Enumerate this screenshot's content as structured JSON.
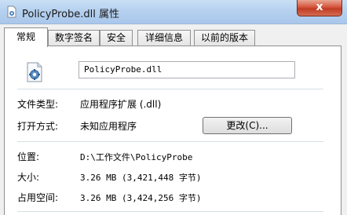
{
  "window": {
    "title": "PolicyProbe.dll 属性",
    "close_label": "x"
  },
  "tabs": [
    {
      "label": "常规",
      "active": true
    },
    {
      "label": "数字签名",
      "active": false
    },
    {
      "label": "安全",
      "active": false
    },
    {
      "label": "详细信息",
      "active": false
    },
    {
      "label": "以前的版本",
      "active": false
    }
  ],
  "general": {
    "file_name": "PolicyProbe.dll",
    "file_type_label": "文件类型:",
    "file_type_value": "应用程序扩展 (.dll)",
    "opens_with_label": "打开方式:",
    "opens_with_value": "未知应用程序",
    "change_button": "更改(C)...",
    "location_label": "位置:",
    "location_value": "D:\\工作文件\\PolicyProbe",
    "size_label": "大小:",
    "size_value": "3.26 MB (3,421,448 字节)",
    "size_on_disk_label": "占用空间:",
    "size_on_disk_value": "3.26 MB (3,424,256 字节)"
  },
  "icons": {
    "title": "dll-file-icon",
    "file": "dll-file-icon"
  }
}
